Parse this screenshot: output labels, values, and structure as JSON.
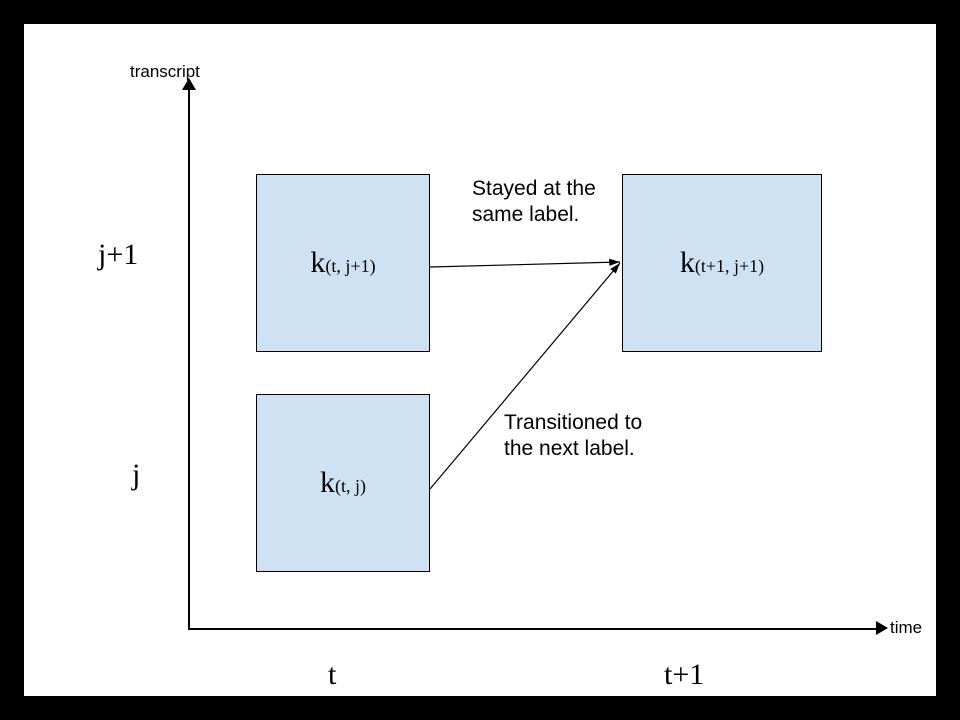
{
  "axes": {
    "y_label": "transcript",
    "x_label": "time",
    "y_ticks": {
      "j": "j",
      "jp1": "j+1"
    },
    "x_ticks": {
      "t": "t",
      "tp1": "t+1"
    }
  },
  "nodes": {
    "tl": {
      "k": "k",
      "sub": "(t, j+1)"
    },
    "bl": {
      "k": "k",
      "sub": "(t, j)"
    },
    "tr": {
      "k": "k",
      "sub": "(t+1, j+1)"
    }
  },
  "annotations": {
    "stayed": "Stayed at the\nsame label.",
    "transitioned": "Transitioned to\nthe next label."
  }
}
